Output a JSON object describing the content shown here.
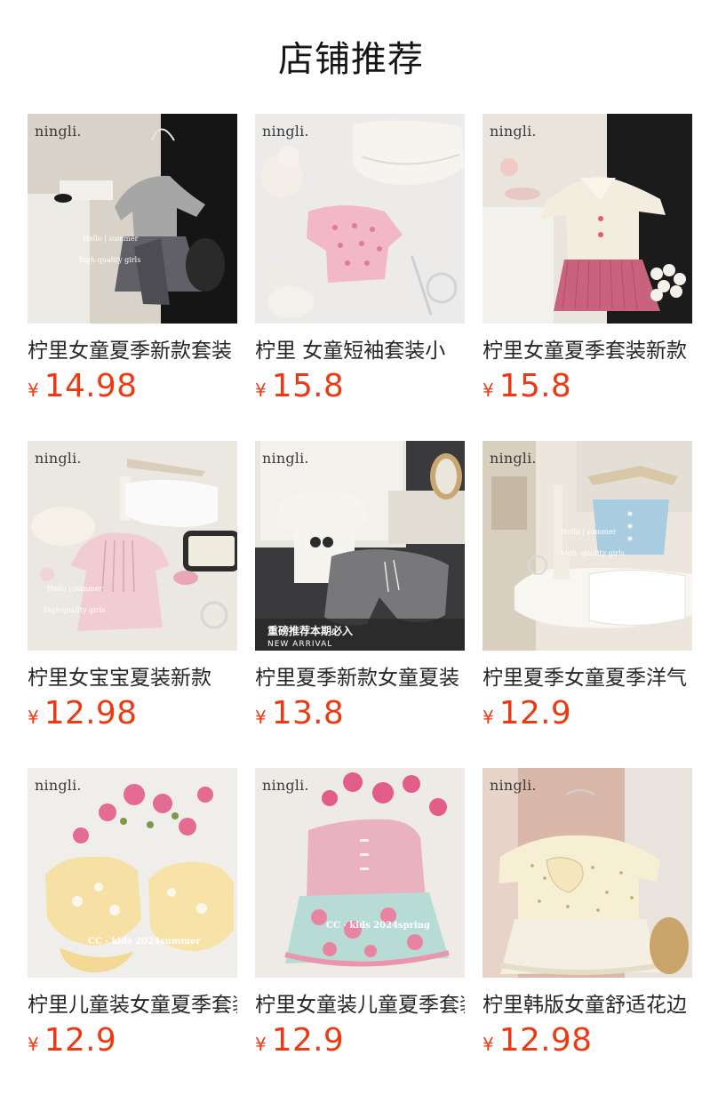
{
  "page": {
    "title": "店铺推荐"
  },
  "colors": {
    "price": "#ea3c14",
    "title_text": "#262626"
  },
  "brand_watermark": "ningli.",
  "products": [
    {
      "title": "柠里女童夏季新款套装",
      "currency": "¥",
      "price": "14.98",
      "image": "gray-top-tulle-skirt",
      "overlay": [
        "Hello | summer",
        "high-quality girls"
      ]
    },
    {
      "title": "柠里 女童短袖套装小",
      "currency": "¥",
      "price": "15.8",
      "image": "pink-bow-tee-white-skirt",
      "overlay": []
    },
    {
      "title": "柠里女童夏季套装新款",
      "currency": "¥",
      "price": "15.8",
      "image": "cream-collar-pink-pleated-dress",
      "overlay": []
    },
    {
      "title": "柠里女宝宝夏装新款",
      "currency": "¥",
      "price": "12.98",
      "image": "pink-pleated-dress-white-shorts",
      "overlay": [
        "Hello | summer",
        "high-quality girls"
      ]
    },
    {
      "title": "柠里夏季新款女童夏装",
      "currency": "¥",
      "price": "13.8",
      "image": "white-tee-gray-shorts",
      "overlay": [
        "重磅推荐本期必入",
        "NEW ARRIVAL"
      ]
    },
    {
      "title": "柠里夏季女童夏季洋气",
      "currency": "¥",
      "price": "12.9",
      "image": "blue-knit-top-white-skirt",
      "overlay": [
        "Hello | summer",
        "high -quality girls"
      ]
    },
    {
      "title": "柠里儿童装女童夏季套装",
      "currency": "¥",
      "price": "12.9",
      "image": "yellow-bubble-set",
      "overlay": [
        "CC · kids 2024summer"
      ]
    },
    {
      "title": "柠里女童装儿童夏季套装",
      "currency": "¥",
      "price": "12.9",
      "image": "pink-floral-ruffle-set",
      "overlay": [
        "CC · kids 2024spring"
      ]
    },
    {
      "title": "柠里韩版女童舒适花边",
      "currency": "¥",
      "price": "12.98",
      "image": "cream-dot-tee-lace-skirt",
      "overlay": []
    }
  ]
}
